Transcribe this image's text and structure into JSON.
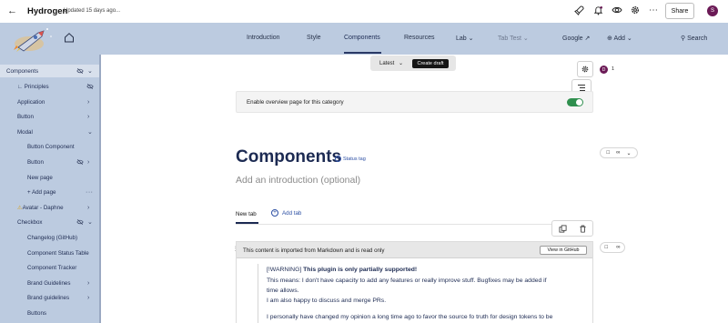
{
  "topbar": {
    "title": "Hydrogen",
    "updated": "Updated 15 days ago...",
    "share_label": "Share",
    "avatar_initial": "S",
    "icons": [
      "rocket-icon",
      "bell-icon",
      "eye-icon",
      "gear-icon",
      "more-icon"
    ]
  },
  "nav": {
    "items": [
      "Introduction",
      "Style",
      "Components",
      "Resources",
      "Lab",
      "Tab Test",
      "Google",
      "Add",
      "Search"
    ],
    "active": "Components"
  },
  "sidebar": {
    "items": [
      {
        "label": "Components"
      },
      {
        "label": "Principles"
      },
      {
        "label": "Application"
      },
      {
        "label": "Button"
      },
      {
        "label": "Modal"
      },
      {
        "label": "Button Component"
      },
      {
        "label": "Button"
      },
      {
        "label": "New page"
      },
      {
        "label": "+ Add page"
      },
      {
        "label": "Avatar - Daphne"
      },
      {
        "label": "Checkbox"
      },
      {
        "label": "Changelog (GitHub)"
      },
      {
        "label": "Component Status Table"
      },
      {
        "label": "Component Tracker"
      },
      {
        "label": "Brand Guidelines"
      },
      {
        "label": "Brand guidelines"
      },
      {
        "label": "Buttons"
      }
    ]
  },
  "branch": {
    "latest_label": "Latest",
    "create_draft_label": "Create draft"
  },
  "collaborators": {
    "avatar_initial": "D",
    "count": "1"
  },
  "overview": {
    "label": "Enable overview page for this category",
    "enabled": true
  },
  "page": {
    "title": "Components",
    "status_tag_label": "Status tag",
    "intro_placeholder": "Add an introduction (optional)"
  },
  "tabs": {
    "new_tab_label": "New tab",
    "add_tab_label": "Add tab"
  },
  "import_block": {
    "notice": "This content is imported from Markdown and is read only",
    "view_button_label": "View in GitHub",
    "warning_prefix": "[!WARNING]",
    "warning_bold": "This plugin is only partially supported!",
    "lines": [
      "This means: I don't have capacity to add any features or really improve stuff. Bugfixes may be added if",
      "time allows.",
      "I am also happy to discuss and merge PRs.",
      "I personally have changed my opinion a long time ago to favor the source fo truth for design tokens to be"
    ]
  },
  "colors": {
    "nav_bg": "#bccbe0",
    "accent": "#1c2a52",
    "toggle_on": "#2f8f4e",
    "avatar": "#6b1a56"
  }
}
